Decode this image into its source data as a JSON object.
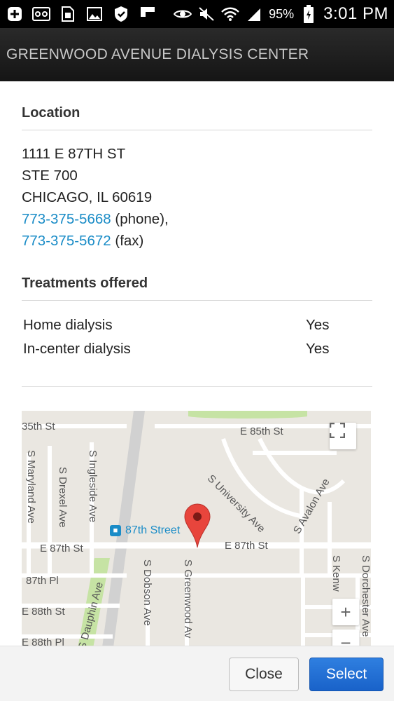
{
  "status_bar": {
    "battery_percent": "95%",
    "time": "3:01 PM",
    "icons": [
      "add-box-icon",
      "voicemail-icon",
      "sim-icon",
      "image-icon",
      "shield-icon",
      "flipboard-icon",
      "eye-icon",
      "mute-icon",
      "wifi-icon",
      "signal-icon",
      "battery-charging-icon"
    ]
  },
  "app_bar": {
    "title": "GREENWOOD AVENUE DIALYSIS CENTER"
  },
  "location": {
    "heading": "Location",
    "address_line1": "1111 E 87TH ST",
    "address_line2": "STE 700",
    "city_state_zip": "CHICAGO, IL 60619",
    "phone": "773-375-5668",
    "phone_suffix": " (phone),",
    "fax": "773-375-5672",
    "fax_suffix": " (fax)"
  },
  "treatments": {
    "heading": "Treatments offered",
    "rows": [
      {
        "name": "Home dialysis",
        "value": "Yes"
      },
      {
        "name": "In-center dialysis",
        "value": "Yes"
      }
    ]
  },
  "map": {
    "labels": {
      "st_35": "35th St",
      "e85": "E 85th St",
      "s_maryland": "S Maryland Ave",
      "s_drexel": "S Drexel Ave",
      "s_ingleside": "S Ingleside Ave",
      "s_university": "S University Ave",
      "s_avalon": "S Avalon Ave",
      "station": "87th Street",
      "e87_left": "E 87th St",
      "e87_right": "E 87th St",
      "st_87pl": "87th Pl",
      "s_dauphin": "S Dauphin Ave",
      "s_dobson": "S Dobson Ave",
      "s_greenwood": "S Greenwood Av",
      "s_kenw": "S Kenw",
      "s_dorchester": "S Dorchester Ave",
      "e88": "E 88th St",
      "e88pl": "E 88th Pl"
    },
    "zoom_in": "+",
    "zoom_out": "−",
    "marker_color": "#e8453c"
  },
  "buttons": {
    "close": "Close",
    "select": "Select"
  }
}
